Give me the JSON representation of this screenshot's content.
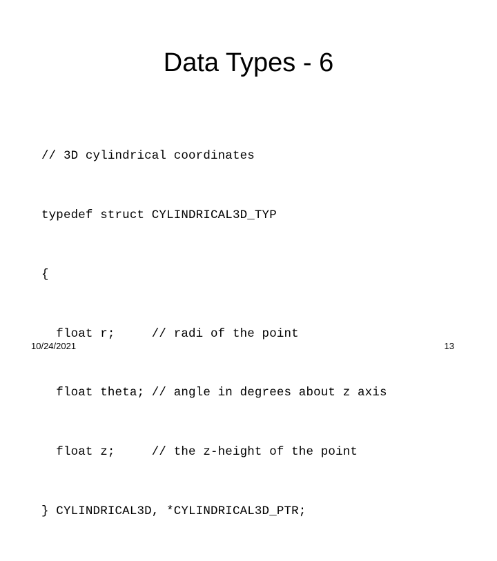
{
  "slide": {
    "title": "Data Types - 6",
    "background_color": "#ffffff",
    "text_color": "#000000",
    "code": {
      "lines": [
        "// 3D cylindrical coordinates",
        "typedef struct CYLINDRICAL3D_TYP",
        "{",
        "  float r;     // radi of the point",
        "  float theta; // angle in degrees about z axis",
        "  float z;     // the z-height of the point",
        "} CYLINDRICAL3D, *CYLINDRICAL3D_PTR;"
      ]
    },
    "footer": {
      "date": "10/24/2021",
      "page_number": "13"
    }
  }
}
